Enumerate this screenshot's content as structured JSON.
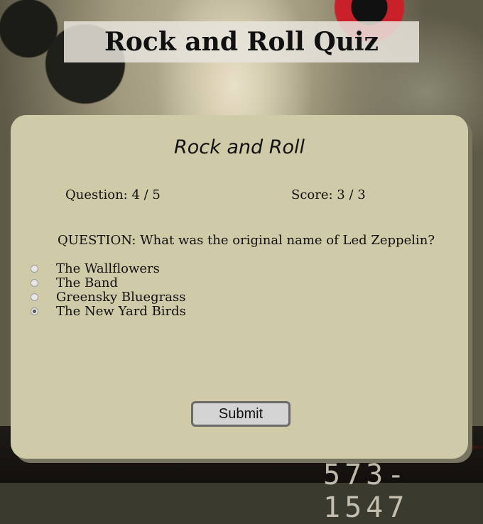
{
  "header": {
    "title": "Rock and Roll Quiz"
  },
  "quiz": {
    "category": "Rock and Roll",
    "question_counter": "Question: 4 / 5",
    "score": "Score: 3 / 3",
    "question": "QUESTION: What was the original name of Led Zeppelin?",
    "options": [
      {
        "label": "The Wallflowers",
        "selected": false
      },
      {
        "label": "The Band",
        "selected": false
      },
      {
        "label": "Greensky Bluegrass",
        "selected": false
      },
      {
        "label": "The New Yard Birds",
        "selected": true
      }
    ],
    "submit_label": "Submit"
  },
  "background": {
    "number_text": "573-1547"
  }
}
